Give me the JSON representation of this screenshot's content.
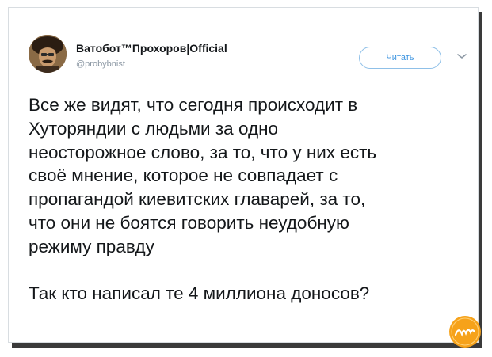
{
  "tweet": {
    "display_name": "Ватобот™Прохоров|Official",
    "handle": "@probybnist",
    "follow_label": "Читать",
    "text": "Все же видят, что сегодня происходит в\nХуторяндии с людьми за одно\nнеосторожное слово, за то, что у них есть\nсвоё мнение, которое не совпадает с\nпропагандой киевитских главарей, за то,\nчто они не боятся говорить неудобную\nрежиму правду\n\nТак кто написал те 4 миллиона доносов?"
  },
  "icons": {
    "avatar": "avatar-photo",
    "menu": "chevron-down-icon",
    "watermark": "logo-watermark"
  },
  "colors": {
    "accent": "#1da1f2",
    "text": "#14171a",
    "muted": "#8b97a3",
    "watermark": "#f6a21a"
  }
}
